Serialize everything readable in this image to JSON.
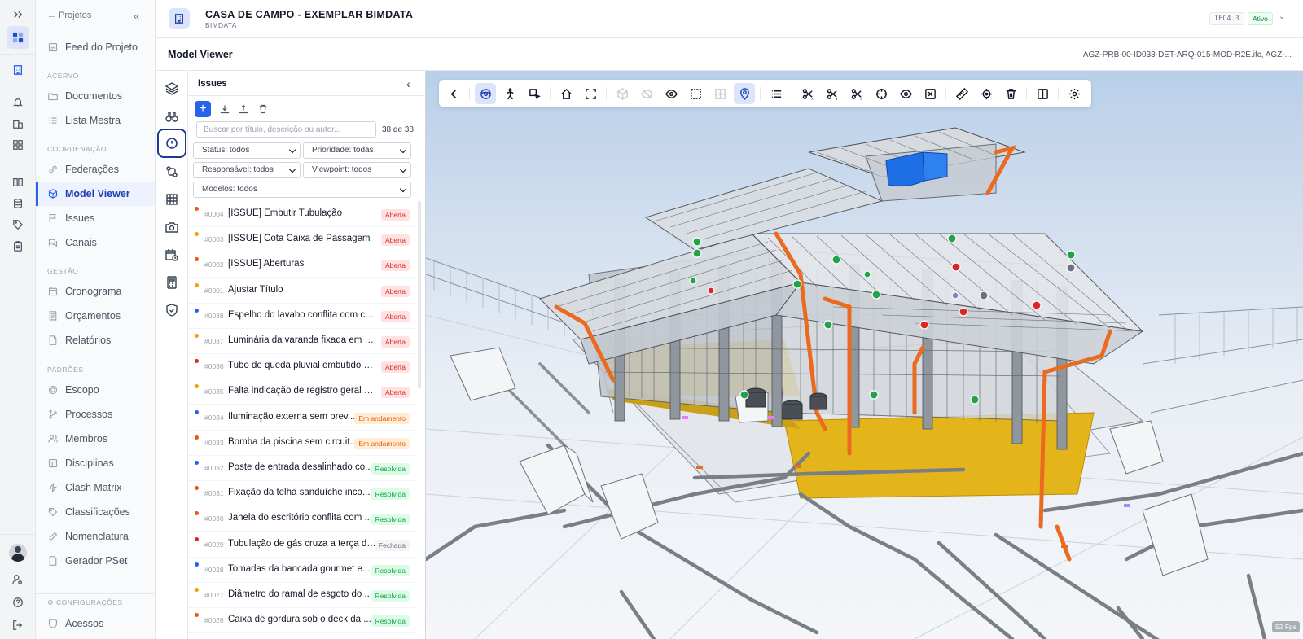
{
  "header": {
    "title": "CASA DE CAMPO - EXEMPLAR BIMDATA",
    "subtitle": "BIMDATA",
    "badge_version": "IFC4.3",
    "badge_status": "Ativo"
  },
  "viewer_header": {
    "title": "Model Viewer",
    "file": "AGZ-PRB-00-ID033-DET-ARQ-015-MOD-R2E.ifc, AGZ-..."
  },
  "sidebar": {
    "back": "← Projetos",
    "sections": {
      "acervo": "ACERVO",
      "coordenacao": "COORDENAÇÃO",
      "gestao": "GESTÃO",
      "padroes": "PADRÕES",
      "config": "CONFIGURAÇÕES"
    },
    "items": {
      "feed": "Feed do Projeto",
      "documentos": "Documentos",
      "lista": "Lista Mestra",
      "federacoes": "Federações",
      "model_viewer": "Model Viewer",
      "issues": "Issues",
      "canais": "Canais",
      "cronograma": "Cronograma",
      "orcamentos": "Orçamentos",
      "relatorios": "Relatórios",
      "escopo": "Escopo",
      "processos": "Processos",
      "membros": "Membros",
      "disciplinas": "Disciplinas",
      "clash": "Clash Matrix",
      "classificacoes": "Classificações",
      "nomenclatura": "Nomenclatura",
      "gerador": "Gerador PSet",
      "acessos": "Acessos"
    }
  },
  "issues": {
    "title": "Issues",
    "search_placeholder": "Buscar por título, descrição ou autor...",
    "count": "38 de 38",
    "filters": {
      "status": "Status: todos",
      "prioridade": "Prioridade: todas",
      "responsavel": "Responsável: todos",
      "viewpoint": "Viewpoint: todos",
      "modelos": "Modelos: todos"
    },
    "rows": [
      {
        "num": "#0004",
        "title": "[ISSUE] Embutir Tubulação",
        "status": "Aberta",
        "cls": "ab",
        "dot": "#ea580c"
      },
      {
        "num": "#0003",
        "title": "[ISSUE] Cota Caixa de Passagem",
        "status": "Aberta",
        "cls": "ab",
        "dot": "#f59e0b"
      },
      {
        "num": "#0002",
        "title": "[ISSUE] Aberturas",
        "status": "Aberta",
        "cls": "ab",
        "dot": "#ea580c"
      },
      {
        "num": "#0001",
        "title": "Ajustar Título",
        "status": "Aberta",
        "cls": "ab",
        "dot": "#f59e0b"
      },
      {
        "num": "#0038",
        "title": "Espelho do lavabo conflita com cai...",
        "status": "Aberta",
        "cls": "ab",
        "dot": "#2563eb"
      },
      {
        "num": "#0037",
        "title": "Luminária da varanda fixada em ter...",
        "status": "Aberta",
        "cls": "ab",
        "dot": "#f59e0b"
      },
      {
        "num": "#0036",
        "title": "Tubo de queda pluvial embutido n...",
        "status": "Aberta",
        "cls": "ab",
        "dot": "#dc2626"
      },
      {
        "num": "#0035",
        "title": "Falta indicação de registro geral no...",
        "status": "Aberta",
        "cls": "ab",
        "dot": "#f59e0b"
      },
      {
        "num": "#0034",
        "title": "Iluminação externa sem prev...",
        "status": "Em andamento",
        "cls": "an",
        "dot": "#2563eb"
      },
      {
        "num": "#0033",
        "title": "Bomba da piscina sem circuit...",
        "status": "Em andamento",
        "cls": "an",
        "dot": "#ea580c"
      },
      {
        "num": "#0032",
        "title": "Poste de entrada desalinhado co...",
        "status": "Resolvida",
        "cls": "rs",
        "dot": "#2563eb"
      },
      {
        "num": "#0031",
        "title": "Fixação da telha sanduíche inco...",
        "status": "Resolvida",
        "cls": "rs",
        "dot": "#ea580c"
      },
      {
        "num": "#0030",
        "title": "Janela do escritório conflita com ...",
        "status": "Resolvida",
        "cls": "rs",
        "dot": "#ea580c"
      },
      {
        "num": "#0029",
        "title": "Tubulação de gás cruza a terça da ...",
        "status": "Fechada",
        "cls": "fc",
        "dot": "#dc2626"
      },
      {
        "num": "#0028",
        "title": "Tomadas da bancada gourmet e...",
        "status": "Resolvida",
        "cls": "rs",
        "dot": "#2563eb"
      },
      {
        "num": "#0027",
        "title": "Diâmetro do ramal de esgoto do ...",
        "status": "Resolvida",
        "cls": "rs",
        "dot": "#f59e0b"
      },
      {
        "num": "#0026",
        "title": "Caixa de gordura sob o deck da ...",
        "status": "Resolvida",
        "cls": "rs",
        "dot": "#ea580c"
      }
    ]
  },
  "viewer": {
    "fps": "52 Fps"
  }
}
